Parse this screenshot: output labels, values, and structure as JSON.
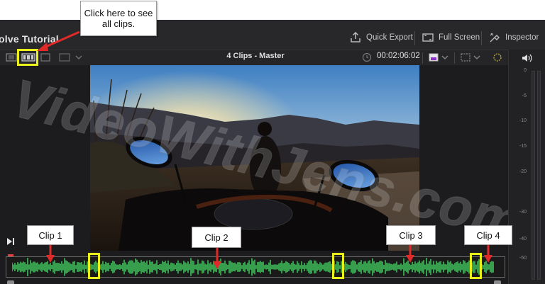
{
  "app": {
    "title": "olve Tutorial"
  },
  "titlebar": {
    "quick_export_label": "Quick Export",
    "full_screen_label": "Full Screen",
    "inspector_label": "Inspector"
  },
  "viewer": {
    "clips_title": "4 Clips - Master",
    "timecode": "00:02:06:02"
  },
  "annotations": {
    "callout": "Click here to see all clips.",
    "clip1": "Clip 1",
    "clip2": "Clip 2",
    "clip3": "Clip 3",
    "clip4": "Clip 4",
    "watermark": "VideoWithJens.com"
  },
  "meter": {
    "labels": [
      "0",
      "-5",
      "-10",
      "-15",
      "-20",
      "-30",
      "-40",
      "-50"
    ]
  },
  "colors": {
    "highlight": "#e9f01a",
    "arrow": "#e02a2a",
    "waveform": "#3fbf5a"
  }
}
